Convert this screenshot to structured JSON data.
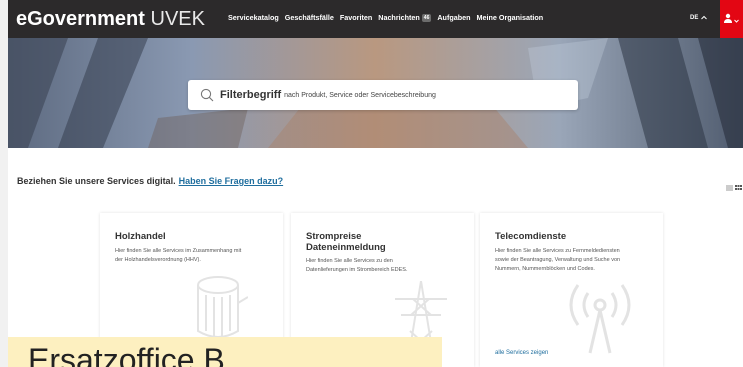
{
  "header": {
    "brand_bold": "eGovernment",
    "brand_light": "UVEK",
    "nav": [
      {
        "label": "Servicekatalog"
      },
      {
        "label": "Geschäftsfälle"
      },
      {
        "label": "Favoriten"
      },
      {
        "label": "Nachrichten",
        "badge": "46"
      },
      {
        "label": "Aufgaben"
      },
      {
        "label": "Meine Organisation"
      }
    ],
    "language": "DE",
    "accent_color": "#e30613"
  },
  "search": {
    "label_strong": "Filterbegriff",
    "label_rest": "nach Produkt, Service oder Servicebeschreibung"
  },
  "intro": {
    "text": "Beziehen Sie unsere Services digital.",
    "link": "Haben Sie Fragen dazu?"
  },
  "cards": [
    {
      "title_line1": "Holzhandel",
      "title_line2": "",
      "desc_line1": "Hier finden Sie alle Services im Zusammenhang mit",
      "desc_line2": "der Holzhandelsverordnung (HHV).",
      "desc_line3": "",
      "icon": "wood-log-icon",
      "link": ""
    },
    {
      "title_line1": "Strompreise",
      "title_line2": "Dateneinmeldung",
      "desc_line1": "Hier finden Sie alle Services zu den",
      "desc_line2": "Datenlieferungen im Strombereich EDES.",
      "desc_line3": "",
      "icon": "power-pylon-icon",
      "link": ""
    },
    {
      "title_line1": "Telecomdienste",
      "title_line2": "",
      "desc_line1": "Hier finden Sie alle Services zu Fernmeldediensten",
      "desc_line2": "sowie der Beantragung, Verwaltung und Suche von",
      "desc_line3": "Nummern, Nummernblöcken und Codes.",
      "icon": "antenna-icon",
      "link": "alle Services zeigen"
    }
  ],
  "overlay": {
    "text": "Ersatzoffice B"
  }
}
